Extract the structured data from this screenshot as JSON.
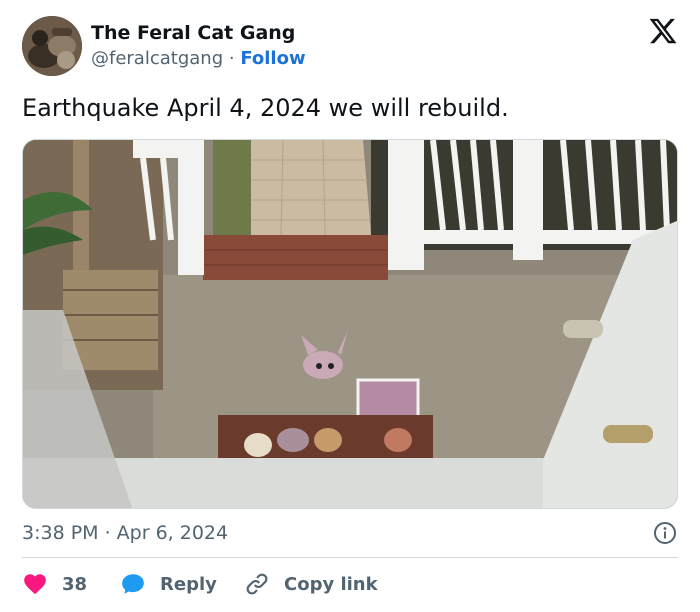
{
  "author": {
    "display_name": "The Feral Cat Gang",
    "handle": "@feralcatgang",
    "separator": "·",
    "follow_label": "Follow"
  },
  "tweet": {
    "text": "Earthquake April 4, 2024 we will rebuild."
  },
  "meta": {
    "timestamp": "3:38 PM · Apr 6, 2024"
  },
  "actions": {
    "like_count": "38",
    "reply_label": "Reply",
    "copy_link_label": "Copy link"
  },
  "icons": {
    "brand": "x-logo-icon",
    "info": "info-icon",
    "like": "heart-icon",
    "reply": "speech-bubble-icon",
    "copy": "link-icon"
  },
  "colors": {
    "like": "#f91880",
    "reply": "#1d9bf0",
    "follow": "#1d72d6",
    "muted": "#536471"
  }
}
